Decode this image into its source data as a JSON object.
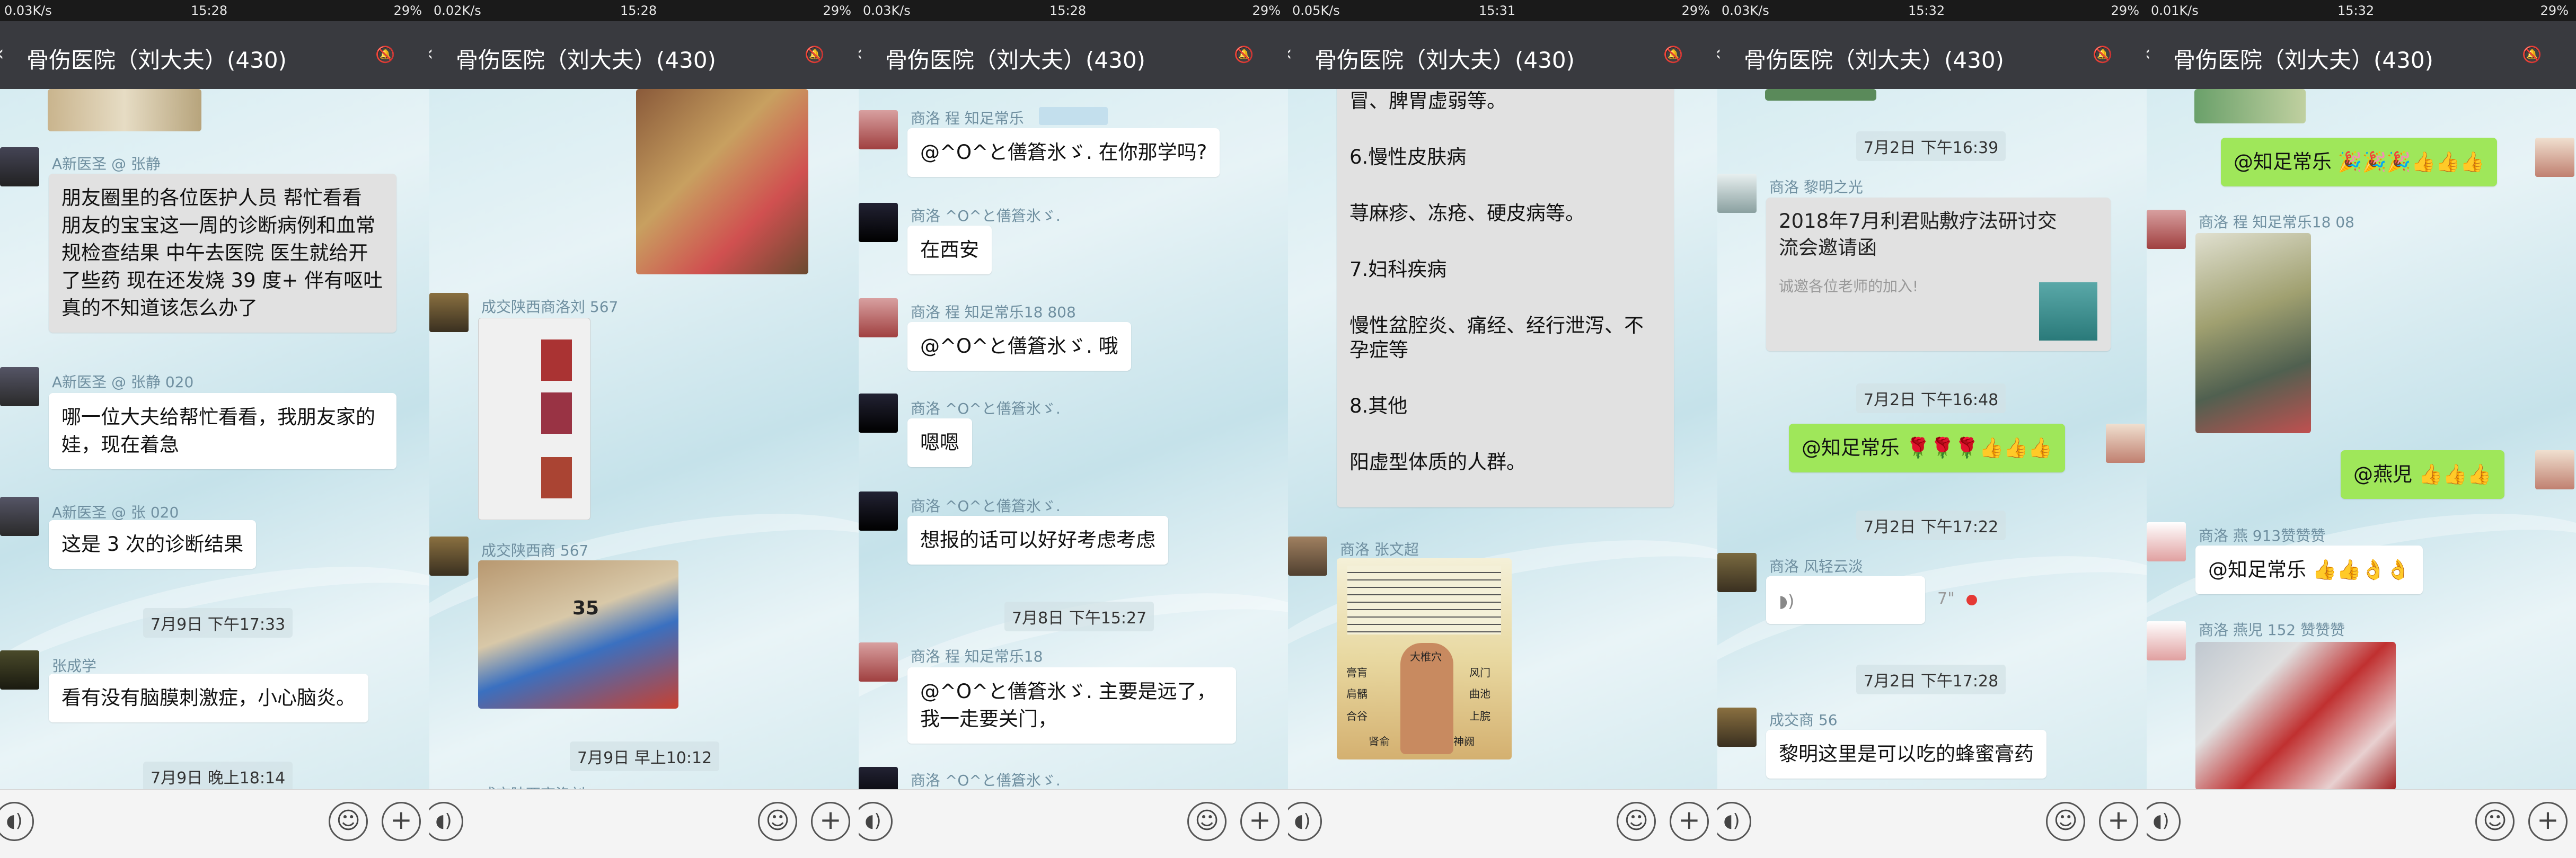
{
  "panels": [
    {
      "status": {
        "speed": "0.03K/s",
        "time": "15:28",
        "battery": "29%"
      },
      "title": "骨伤医院（刘大夫）(430)",
      "messages": {
        "m1_sender": "A新医圣 @ 张静",
        "m1_text": "朋友圈里的各位医护人员 帮忙看看 朋友的宝宝这一周的诊断病例和血常规检查结果 中午去医院 医生就给开了些药 现在还发烧 39 度+ 伴有呕吐 真的不知道该怎么办了",
        "m2_sender": "A新医圣 @ 张静                  020",
        "m2_text": "哪一位大夫给帮忙看看，我朋友家的娃，现在着急",
        "m3_sender": "A新医圣 @ 张                   020",
        "m3_text": "这是 3 次的诊断结果",
        "time1": "7月9日 下午17:33",
        "m4_sender": "张成学",
        "m4_text": "看有没有脑膜刺激症，小心脑炎。",
        "time2": "7月9日 晚上18:14"
      }
    },
    {
      "status": {
        "speed": "0.02K/s",
        "time": "15:28",
        "battery": "29%"
      },
      "title": "骨伤医院（刘大夫）(430)",
      "messages": {
        "m1_sender": "成交陕西商洛刘                 567",
        "m2_sender": "成交陕西商                     567",
        "box_label": "35",
        "time1": "7月9日 早上10:12",
        "m3_sender": "成交陕西商洛刘"
      }
    },
    {
      "status": {
        "speed": "0.03K/s",
        "time": "15:28",
        "battery": "29%"
      },
      "title": "骨伤医院（刘大夫）(430)",
      "messages": {
        "m1_sender": "商洛 程 知足常乐",
        "m1_text": "@^O^と僐篬氷ゞ. 在你那学吗?",
        "m2_sender": "商洛 ^O^と僐篬氷ゞ.",
        "m2_text": "在西安",
        "m3_sender": "商洛 程 知足常乐18          808",
        "m3_text": "@^O^と僐篬氷ゞ. 哦",
        "m4_sender": "商洛 ^O^と僐篬氷ゞ.",
        "m4_text": "嗯嗯",
        "m5_sender": "商洛 ^O^と僐篬氷ゞ.",
        "m5_text": "想报的话可以好好考虑考虑",
        "time1": "7月8日 下午15:27",
        "m6_sender": "商洛 程 知足常乐18",
        "m6_text": "@^O^と僐篬氷ゞ. 主要是远了，我一走要关门，",
        "m7_sender": "商洛 ^O^と僐篬氷ゞ."
      }
    },
    {
      "status": {
        "speed": "0.05K/s",
        "time": "15:31",
        "battery": "29%"
      },
      "title": "骨伤医院（刘大夫）(430)",
      "messages": {
        "doc_line0": "冒、脾胃虚弱等。",
        "doc_line1": "6.慢性皮肤病",
        "doc_line2": "荨麻疹、冻疮、硬皮病等。",
        "doc_line3": "7.妇科疾病",
        "doc_line4": "慢性盆腔炎、痛经、经行泄泻、不孕症等",
        "doc_line5": "8.其他",
        "doc_line6": "阳虚型体质的人群。",
        "m1_sender": "商洛 张文超",
        "poster_title": "大椎穴",
        "poster_l1": "膏肓",
        "poster_l2": "风门",
        "poster_l3": "肩髃",
        "poster_l4": "曲池",
        "poster_l5": "合谷",
        "poster_l6": "上脘",
        "poster_l7": "肾俞",
        "poster_l8": "神阙"
      }
    },
    {
      "status": {
        "speed": "0.03K/s",
        "time": "15:32",
        "battery": "29%"
      },
      "title": "骨伤医院（刘大夫）(430)",
      "messages": {
        "time1": "7月2日 下午16:39",
        "m1_sender": "商洛 黎明之光",
        "card_title": "2018年7月利君贴敷疗法研讨交流会邀请函",
        "card_desc": "诚邀各位老师的加入!",
        "time2": "7月2日 下午16:48",
        "m2_text": "@知足常乐 🌹🌹🌹👍👍👍",
        "time3": "7月2日 下午17:22",
        "m3_sender": "商洛 风轻云淡",
        "m3_duration": "7\"",
        "time4": "7月2日 下午17:28",
        "m4_sender": "成交商                  56",
        "m4_text": "黎明这里是可以吃的蜂蜜膏药"
      }
    },
    {
      "status": {
        "speed": "0.01K/s",
        "time": "15:32",
        "battery": "29%"
      },
      "title": "骨伤医院（刘大夫）(430)",
      "messages": {
        "m1_text": "@知足常乐 🎉🎉🎉👍👍👍",
        "m2_sender": "商洛 程 知足常乐18                 08",
        "m3_text": "@燕児 👍👍👍",
        "m4_sender": "商洛 燕                    913赞赞赞",
        "m4_text": "@知足常乐 👍👍👌👌",
        "m5_sender": "商洛 燕児 152                  赞赞赞"
      }
    }
  ],
  "icons": {
    "back": "back-icon",
    "mute": "bell-muted-icon",
    "voice": "voice-icon",
    "emoji": "emoji-icon",
    "plus": "plus-icon"
  },
  "colors": {
    "titlebar": "#393a3f",
    "statusbar": "#1a1a1a",
    "bubble_self": "#9fe75a",
    "bubble_other": "#ffffff"
  }
}
